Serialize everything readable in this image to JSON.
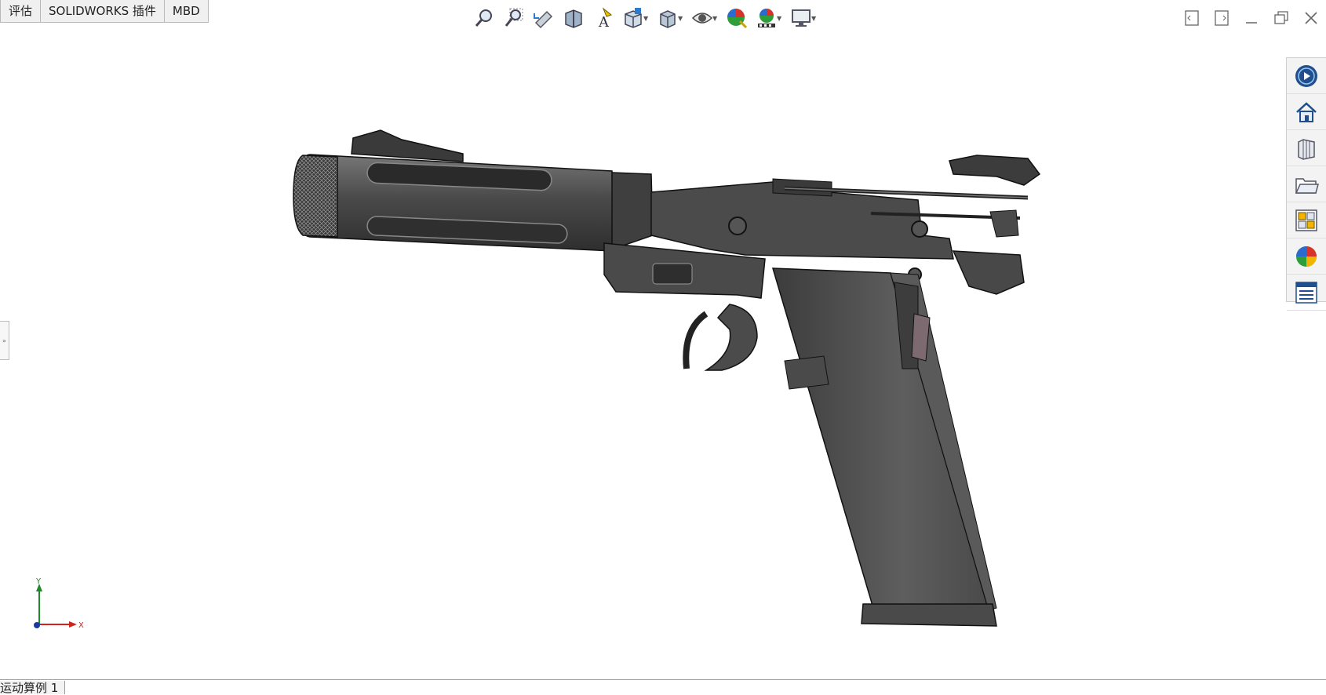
{
  "tabs": [
    "评估",
    "SOLIDWORKS 插件",
    "MBD"
  ],
  "view_toolbar": [
    {
      "icon": "zoom-to-fit-icon",
      "dropdown": false
    },
    {
      "icon": "zoom-to-area-icon",
      "dropdown": false
    },
    {
      "icon": "previous-view-icon",
      "dropdown": false
    },
    {
      "icon": "section-view-icon",
      "dropdown": false
    },
    {
      "icon": "dynamic-annotation-views-icon",
      "dropdown": false
    },
    {
      "icon": "view-orientation-icon",
      "dropdown": true
    },
    {
      "icon": "display-style-icon",
      "dropdown": true
    },
    {
      "icon": "hide-show-items-icon",
      "dropdown": true
    },
    {
      "icon": "edit-appearance-icon",
      "dropdown": false
    },
    {
      "icon": "apply-scene-icon",
      "dropdown": true
    },
    {
      "icon": "view-settings-icon",
      "dropdown": true
    }
  ],
  "task_pane": [
    "solidworks-resources-icon",
    "home-icon",
    "design-library-icon",
    "file-explorer-icon",
    "view-palette-icon",
    "appearances-scenes-icon",
    "custom-properties-icon"
  ],
  "triad": {
    "x_label": "X",
    "y_label": "Y"
  },
  "status_tab": "运动算例 1"
}
